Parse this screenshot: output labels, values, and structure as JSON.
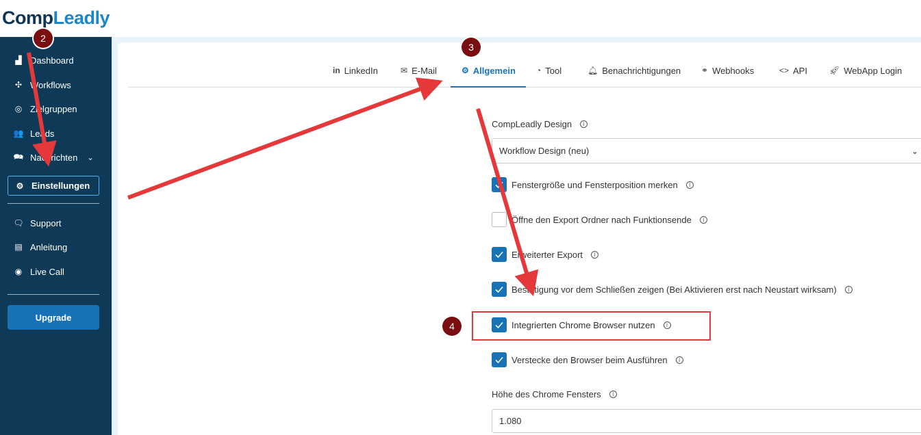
{
  "app": {
    "logo_part1": "Comp",
    "logo_part2": "Leadly"
  },
  "sidebar": {
    "items": [
      {
        "label": "Dashboard",
        "icon": "chart-icon"
      },
      {
        "label": "Workflows",
        "icon": "workflow-icon"
      },
      {
        "label": "Zielgruppen",
        "icon": "target-icon"
      },
      {
        "label": "Leads",
        "icon": "users-icon"
      },
      {
        "label": "Nachrichten",
        "icon": "messages-icon"
      },
      {
        "label": "Einstellungen",
        "icon": "gear-icon",
        "active": true
      },
      {
        "label": "Support",
        "icon": "support-icon"
      },
      {
        "label": "Anleitung",
        "icon": "book-icon"
      },
      {
        "label": "Live Call",
        "icon": "webcam-icon"
      }
    ],
    "upgrade_label": "Upgrade"
  },
  "tabs": [
    {
      "label": "LinkedIn",
      "icon": "linkedin-icon"
    },
    {
      "label": "E-Mail",
      "icon": "mail-icon"
    },
    {
      "label": "Allgemein",
      "icon": "gear-icon",
      "active": true
    },
    {
      "label": "Tool",
      "icon": "gauge-icon"
    },
    {
      "label": "Benachrichtigungen",
      "icon": "bell-icon"
    },
    {
      "label": "Webhooks",
      "icon": "webhook-icon"
    },
    {
      "label": "API",
      "icon": "code-icon"
    },
    {
      "label": "WebApp Login",
      "icon": "rocket-icon"
    }
  ],
  "form": {
    "design_label": "CompLeadly Design",
    "design_value": "Workflow Design (neu)",
    "checkboxes": [
      {
        "label": "Fenstergröße und Fensterposition merken",
        "checked": true
      },
      {
        "label": "Öffne den Export Ordner nach Funktionsende",
        "checked": false
      },
      {
        "label": "Erweiterter Export",
        "checked": true
      },
      {
        "label": "Bestätigung vor dem Schließen zeigen (Bei Aktivieren erst nach Neustart wirksam)",
        "checked": true
      },
      {
        "label": "Integrierten Chrome Browser nutzen",
        "checked": true
      },
      {
        "label": "Verstecke den Browser beim Ausführen",
        "checked": true
      }
    ],
    "height_label": "Höhe des Chrome Fensters",
    "height_value": "1.080"
  },
  "annotations": {
    "markers": [
      "2",
      "3",
      "4"
    ],
    "arrow_color": "#e5383b",
    "marker_color": "#7a0f12"
  },
  "colors": {
    "sidebar": "#0f3a57",
    "accent": "#1773b5"
  }
}
